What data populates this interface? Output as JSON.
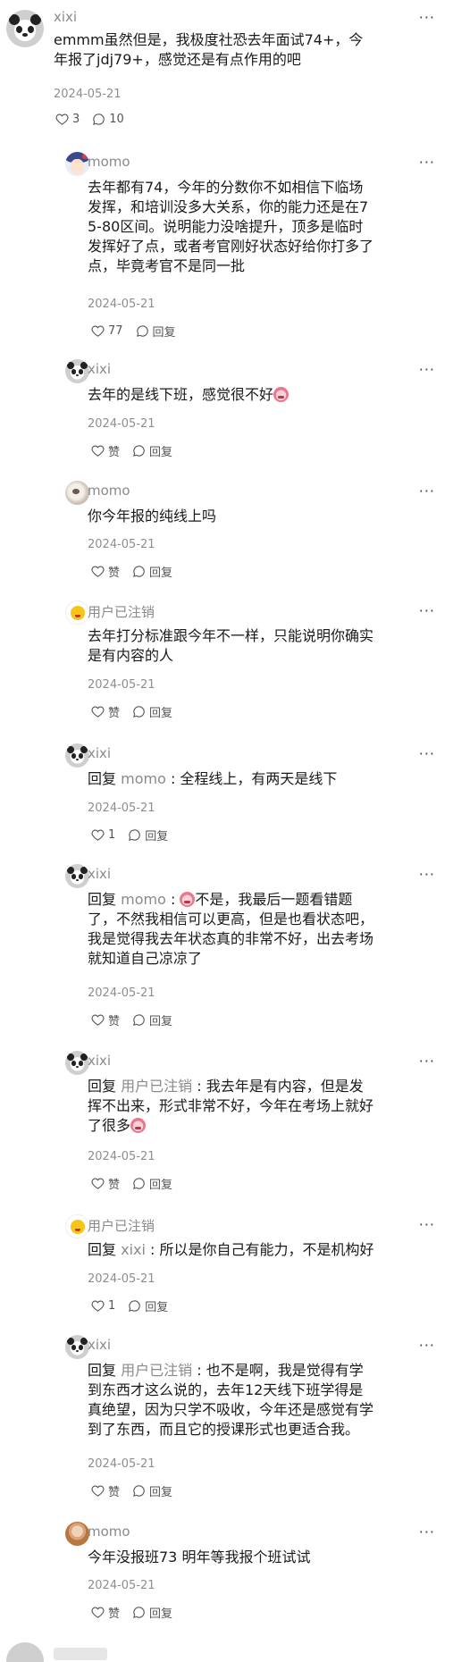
{
  "thread": {
    "main": {
      "author": "xixi",
      "text": "emmm虽然但是，我极度社恐去年面试74+，今年报了jdj79+，感觉还是有点作用的吧",
      "date": "2024-05-21",
      "likes": "3",
      "comments": "10",
      "more": "···"
    },
    "replies": [
      {
        "author": "momo",
        "text": "去年都有74，今年的分数你不如相信下临场发挥，和培训没多大关系，你的能力还是在75-80区间。说明能力没啥提升，顶多是临时发挥好了点，或者考官刚好状态好给你打多了点，毕竟考官不是同一批",
        "date": "2024-05-21",
        "likes": "77",
        "reply_label": "回复"
      },
      {
        "author": "xixi",
        "text": "去年的是线下班，感觉很不好",
        "date": "2024-05-21",
        "likes": "赞",
        "reply_label": "回复"
      },
      {
        "author": "momo",
        "text": "你今年报的纯线上吗",
        "date": "2024-05-21",
        "likes": "赞",
        "reply_label": "回复"
      },
      {
        "author": "用户已注销",
        "text": "去年打分标准跟今年不一样，只能说明你确实是有内容的人",
        "date": "2024-05-21",
        "likes": "赞",
        "reply_label": "回复"
      },
      {
        "author": "xixi",
        "reply_prefix": "回复",
        "mention": "momo",
        "text": "全程线上，有两天是线下",
        "date": "2024-05-21",
        "likes": "1",
        "reply_label": "回复"
      },
      {
        "author": "xixi",
        "reply_prefix": "回复",
        "mention": "momo",
        "text": "不是，我最后一题看错题了，不然我相信可以更高，但是也看状态吧，我是觉得我去年状态真的非常不好，出去考场就知道自己凉凉了",
        "date": "2024-05-21",
        "likes": "赞",
        "reply_label": "回复"
      },
      {
        "author": "xixi",
        "reply_prefix": "回复",
        "mention": "用户已注销",
        "text": "我去年是有内容，但是发挥不出来，形式非常不好，今年在考场上就好了很多",
        "date": "2024-05-21",
        "likes": "赞",
        "reply_label": "回复"
      },
      {
        "author": "用户已注销",
        "reply_prefix": "回复",
        "mention": "xixi",
        "text": "所以是你自己有能力，不是机构好",
        "date": "2024-05-21",
        "likes": "1",
        "reply_label": "回复"
      },
      {
        "author": "xixi",
        "reply_prefix": "回复",
        "mention": "用户已注销",
        "text": "也不是啊，我是觉得有学到东西才这么说的，去年12天线下班学得是真绝望，因为只学不吸收，今年还是感觉有学到了东西，而且它的授课形式也更适合我。",
        "date": "2024-05-21",
        "likes": "赞",
        "reply_label": "回复"
      },
      {
        "author": "momo",
        "text": "今年没报班73 明年等我报个班试试",
        "date": "2024-05-21",
        "likes": "赞",
        "reply_label": "回复"
      }
    ]
  },
  "icons": [
    "heart-outline-icon",
    "comment-bubble-icon",
    "more-dots-icon",
    "sticker-emoji-icon"
  ]
}
